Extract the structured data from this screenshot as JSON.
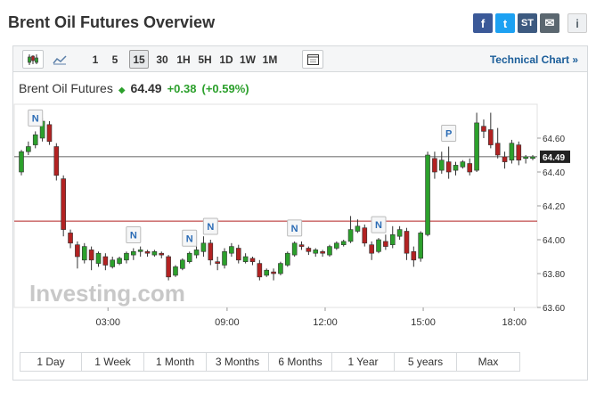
{
  "title": "Brent Oil Futures Overview",
  "share": {
    "facebook": "f",
    "twitter": "t",
    "stocktwits": "ST",
    "email": "✉",
    "info": "i"
  },
  "toolbar": {
    "intervals": [
      "1",
      "5",
      "15",
      "30",
      "1H",
      "5H",
      "1D",
      "1W",
      "1M"
    ],
    "active_interval": "15",
    "technical_chart": "Technical Chart »"
  },
  "quote": {
    "name": "Brent Oil Futures",
    "price": "64.49",
    "change": "+0.38",
    "change_pct": "(+0.59%)"
  },
  "ranges": [
    "1 Day",
    "1 Week",
    "1 Month",
    "3 Months",
    "6 Months",
    "1 Year",
    "5 years",
    "Max"
  ],
  "colors": {
    "up": "#2ca02c",
    "down": "#b22222",
    "prev_close": "#b22222"
  },
  "chart_data": {
    "type": "candlestick",
    "x_ticks": [
      "03:00",
      "09:00",
      "12:00",
      "15:00",
      "18:00"
    ],
    "y_ticks": [
      "64.60",
      "64.40",
      "64.20",
      "64.00",
      "63.80",
      "63.60"
    ],
    "ylim": [
      63.6,
      64.8
    ],
    "last_price": "64.49",
    "prev_close": 64.11,
    "watermark": "Investing.com",
    "candles": [
      [
        64.4,
        64.52,
        64.38,
        64.53
      ],
      [
        64.52,
        64.55,
        64.5,
        64.58
      ],
      [
        64.56,
        64.62,
        64.54,
        64.64
      ],
      [
        64.6,
        64.7,
        64.58,
        64.72
      ],
      [
        64.68,
        64.58,
        64.56,
        64.7
      ],
      [
        64.55,
        64.38,
        64.35,
        64.57
      ],
      [
        64.36,
        64.06,
        64.02,
        64.38
      ],
      [
        64.04,
        63.98,
        63.95,
        64.06
      ],
      [
        63.97,
        63.9,
        63.83,
        63.99
      ],
      [
        63.88,
        63.96,
        63.86,
        63.98
      ],
      [
        63.94,
        63.88,
        63.82,
        63.96
      ],
      [
        63.86,
        63.92,
        63.84,
        63.93
      ],
      [
        63.9,
        63.85,
        63.82,
        63.92
      ],
      [
        63.84,
        63.88,
        63.83,
        63.9
      ],
      [
        63.86,
        63.89,
        63.85,
        63.9
      ],
      [
        63.88,
        63.92,
        63.86,
        63.93
      ],
      [
        63.91,
        63.93,
        63.88,
        63.95
      ],
      [
        63.93,
        63.94,
        63.9,
        63.96
      ],
      [
        63.93,
        63.92,
        63.9,
        63.94
      ],
      [
        63.91,
        63.93,
        63.9,
        63.94
      ],
      [
        63.92,
        63.91,
        63.89,
        63.93
      ],
      [
        63.9,
        63.78,
        63.76,
        63.91
      ],
      [
        63.79,
        63.84,
        63.78,
        63.85
      ],
      [
        63.83,
        63.88,
        63.82,
        63.89
      ],
      [
        63.87,
        63.92,
        63.86,
        63.93
      ],
      [
        63.91,
        63.94,
        63.89,
        63.96
      ],
      [
        63.93,
        63.98,
        63.9,
        64.02
      ],
      [
        63.98,
        63.88,
        63.85,
        64.0
      ],
      [
        63.87,
        63.86,
        63.82,
        63.9
      ],
      [
        63.85,
        63.93,
        63.83,
        63.95
      ],
      [
        63.92,
        63.96,
        63.9,
        63.98
      ],
      [
        63.95,
        63.88,
        63.86,
        63.97
      ],
      [
        63.87,
        63.9,
        63.86,
        63.92
      ],
      [
        63.89,
        63.87,
        63.85,
        63.9
      ],
      [
        63.86,
        63.78,
        63.76,
        63.88
      ],
      [
        63.79,
        63.82,
        63.78,
        63.83
      ],
      [
        63.81,
        63.8,
        63.76,
        63.83
      ],
      [
        63.8,
        63.86,
        63.79,
        63.87
      ],
      [
        63.85,
        63.92,
        63.84,
        63.93
      ],
      [
        63.91,
        63.98,
        63.9,
        63.99
      ],
      [
        63.97,
        63.96,
        63.94,
        63.99
      ],
      [
        63.95,
        63.93,
        63.91,
        63.96
      ],
      [
        63.92,
        63.94,
        63.9,
        63.95
      ],
      [
        63.93,
        63.92,
        63.9,
        63.94
      ],
      [
        63.91,
        63.96,
        63.9,
        63.97
      ],
      [
        63.95,
        63.98,
        63.94,
        63.99
      ],
      [
        63.97,
        63.99,
        63.96,
        64.0
      ],
      [
        63.99,
        64.06,
        63.98,
        64.14
      ],
      [
        64.05,
        64.08,
        64.04,
        64.12
      ],
      [
        64.07,
        63.98,
        63.96,
        64.09
      ],
      [
        63.97,
        63.92,
        63.88,
        63.99
      ],
      [
        63.93,
        64.0,
        63.92,
        64.01
      ],
      [
        63.99,
        63.96,
        63.94,
        64.03
      ],
      [
        63.97,
        64.03,
        63.95,
        64.08
      ],
      [
        64.02,
        64.06,
        64.0,
        64.08
      ],
      [
        64.05,
        63.92,
        63.88,
        64.07
      ],
      [
        63.93,
        63.88,
        63.84,
        63.96
      ],
      [
        63.89,
        64.04,
        63.87,
        64.05
      ],
      [
        64.03,
        64.5,
        64.02,
        64.52
      ],
      [
        64.48,
        64.4,
        64.36,
        64.52
      ],
      [
        64.41,
        64.47,
        64.39,
        64.52
      ],
      [
        64.46,
        64.4,
        64.36,
        64.55
      ],
      [
        64.41,
        64.44,
        64.38,
        64.46
      ],
      [
        64.43,
        64.46,
        64.42,
        64.47
      ],
      [
        64.45,
        64.4,
        64.38,
        64.48
      ],
      [
        64.41,
        64.69,
        64.4,
        64.75
      ],
      [
        64.67,
        64.64,
        64.6,
        64.71
      ],
      [
        64.65,
        64.56,
        64.54,
        64.75
      ],
      [
        64.57,
        64.5,
        64.48,
        64.66
      ],
      [
        64.49,
        64.46,
        64.42,
        64.52
      ],
      [
        64.47,
        64.57,
        64.45,
        64.59
      ],
      [
        64.56,
        64.47,
        64.44,
        64.58
      ],
      [
        64.48,
        64.49,
        64.45,
        64.5
      ],
      [
        64.48,
        64.49,
        64.47,
        64.5
      ]
    ],
    "news_markers": [
      {
        "label": "N",
        "i": 2
      },
      {
        "label": "N",
        "i": 16
      },
      {
        "label": "N",
        "i": 24
      },
      {
        "label": "N",
        "i": 27
      },
      {
        "label": "N",
        "i": 39
      },
      {
        "label": "N",
        "i": 51
      },
      {
        "label": "P",
        "i": 61
      }
    ]
  }
}
